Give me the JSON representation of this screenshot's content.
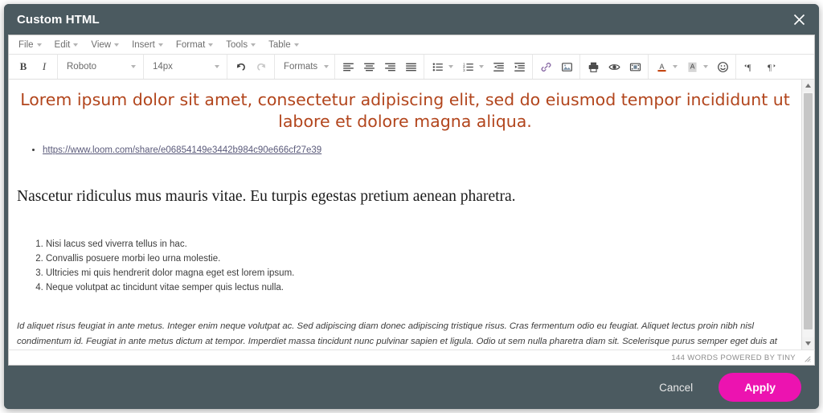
{
  "dialog": {
    "title": "Custom HTML",
    "close_icon": "close-icon"
  },
  "menubar": {
    "items": [
      {
        "label": "File"
      },
      {
        "label": "Edit"
      },
      {
        "label": "View"
      },
      {
        "label": "Insert"
      },
      {
        "label": "Format"
      },
      {
        "label": "Tools"
      },
      {
        "label": "Table"
      }
    ]
  },
  "toolbar": {
    "bold_label": "B",
    "italic_label": "I",
    "fontfamily_value": "Roboto",
    "fontsize_value": "14px",
    "formats_label": "Formats",
    "icons": {
      "undo": "undo-icon",
      "redo": "redo-icon",
      "align_left": "align-left-icon",
      "align_center": "align-center-icon",
      "align_right": "align-right-icon",
      "align_justify": "align-justify-icon",
      "bullet_list": "bullet-list-icon",
      "numbered_list": "numbered-list-icon",
      "outdent": "outdent-icon",
      "indent": "indent-icon",
      "link": "link-icon",
      "image": "image-icon",
      "print": "print-icon",
      "preview": "preview-eye-icon",
      "media": "insert-media-icon",
      "forecolor": "text-color-icon",
      "backcolor": "background-color-icon",
      "emoticons": "emoji-smiley-icon",
      "ltr": "ltr-paragraph-icon",
      "rtl": "rtl-paragraph-icon"
    }
  },
  "document": {
    "heading": "Lorem ipsum dolor sit amet, consectetur adipiscing elit, sed do eiusmod tempor incididunt ut labore et dolore magna aliqua.",
    "heading_color": "#b2451c",
    "bullets": [
      "https://www.loom.com/share/e06854149e3442b984c90e666cf27e39"
    ],
    "serif_paragraph": "Nascetur ridiculus mus mauris vitae. Eu turpis egestas pretium aenean pharetra.",
    "numbered": [
      "Nisi lacus sed viverra tellus in hac.",
      "Convallis posuere morbi leo urna molestie.",
      "Ultricies mi quis hendrerit dolor magna eget est lorem ipsum.",
      "Neque volutpat ac tincidunt vitae semper quis lectus nulla."
    ],
    "italic_paragraph": "Id aliquet risus feugiat in ante metus. Integer enim neque volutpat ac. Sed adipiscing diam donec adipiscing tristique risus. Cras fermentum odio eu feugiat. Aliquet lectus proin nibh nisl condimentum id. Feugiat in ante metus dictum at tempor. Imperdiet massa tincidunt nunc pulvinar sapien et ligula. Odio ut sem nulla pharetra diam sit. Scelerisque purus semper eget duis at tellus. At urna condimentum mattis pellentesque. Vel pretium lectus quam id leo in vitae turpis massa. Eget mauris pharetra et ultrices neque."
  },
  "statusbar": {
    "text": "144 WORDS POWERED BY TINY",
    "resize_icon": "resize-grip-icon"
  },
  "footer": {
    "cancel_label": "Cancel",
    "apply_label": "Apply",
    "apply_color": "#ec13b0"
  },
  "scrollbar": {
    "up_icon": "scroll-up-arrow-icon",
    "down_icon": "scroll-down-arrow-icon"
  }
}
